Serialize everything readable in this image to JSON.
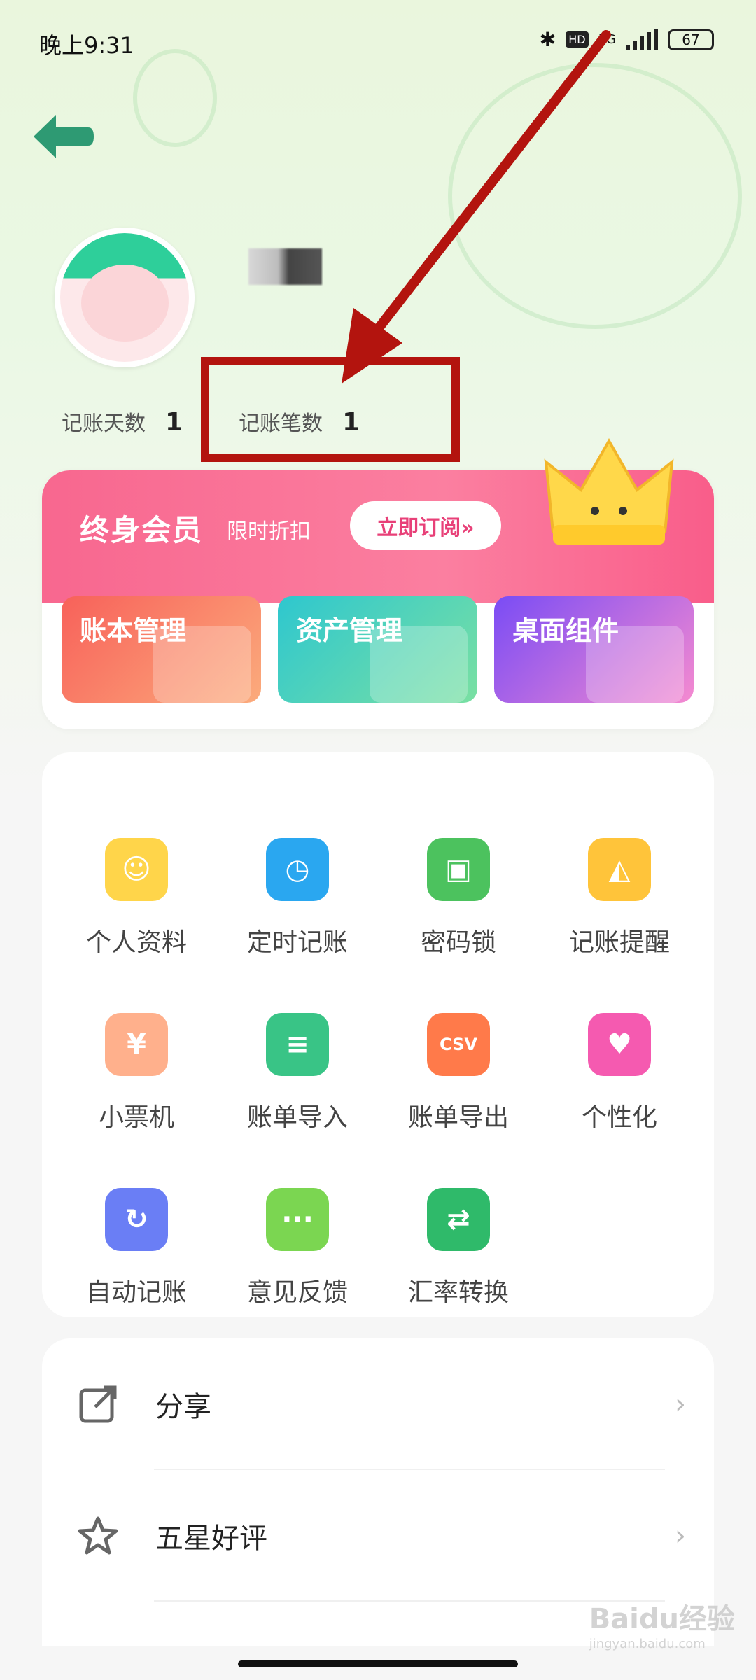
{
  "status_bar": {
    "time": "晚上9:31",
    "network": "5G",
    "hd": "HD",
    "battery": "67"
  },
  "profile": {
    "stats": [
      {
        "label": "记账天数",
        "value": "1"
      },
      {
        "label": "记账笔数",
        "value": "1"
      }
    ]
  },
  "member": {
    "title": "终身会员",
    "subtitle": "限时折扣",
    "button": "立即订阅»"
  },
  "features": [
    {
      "label": "账本管理",
      "color": "#f7735a"
    },
    {
      "label": "资产管理",
      "color": "#3cc9c1"
    },
    {
      "label": "桌面组件",
      "color": "#8a56f2"
    }
  ],
  "grid_items": [
    {
      "label": "个人资料",
      "icon": "smiley-icon",
      "color": "#ffd54a"
    },
    {
      "label": "定时记账",
      "icon": "stopwatch-icon",
      "color": "#2aa7f0"
    },
    {
      "label": "密码锁",
      "icon": "lock-icon",
      "color": "#4cc25e"
    },
    {
      "label": "记账提醒",
      "icon": "bell-icon",
      "color": "#ffc43a"
    },
    {
      "label": "小票机",
      "icon": "receipt-icon",
      "color": "#ffb08c"
    },
    {
      "label": "账单导入",
      "icon": "document-import-icon",
      "color": "#39c486"
    },
    {
      "label": "账单导出",
      "icon": "csv-export-icon",
      "color": "#ff7a4a"
    },
    {
      "label": "个性化",
      "icon": "heart-icon",
      "color": "#f55ab0"
    },
    {
      "label": "自动记账",
      "icon": "refresh-icon",
      "color": "#6a7ef5"
    },
    {
      "label": "意见反馈",
      "icon": "chat-bubble-icon",
      "color": "#7bd651"
    },
    {
      "label": "汇率转换",
      "icon": "exchange-icon",
      "color": "#2fba6a"
    }
  ],
  "list_items": [
    {
      "label": "分享",
      "icon": "share-icon"
    },
    {
      "label": "五星好评",
      "icon": "star-icon"
    }
  ],
  "watermark": {
    "main": "Baidu经验",
    "sub": "jingyan.baidu.com"
  }
}
